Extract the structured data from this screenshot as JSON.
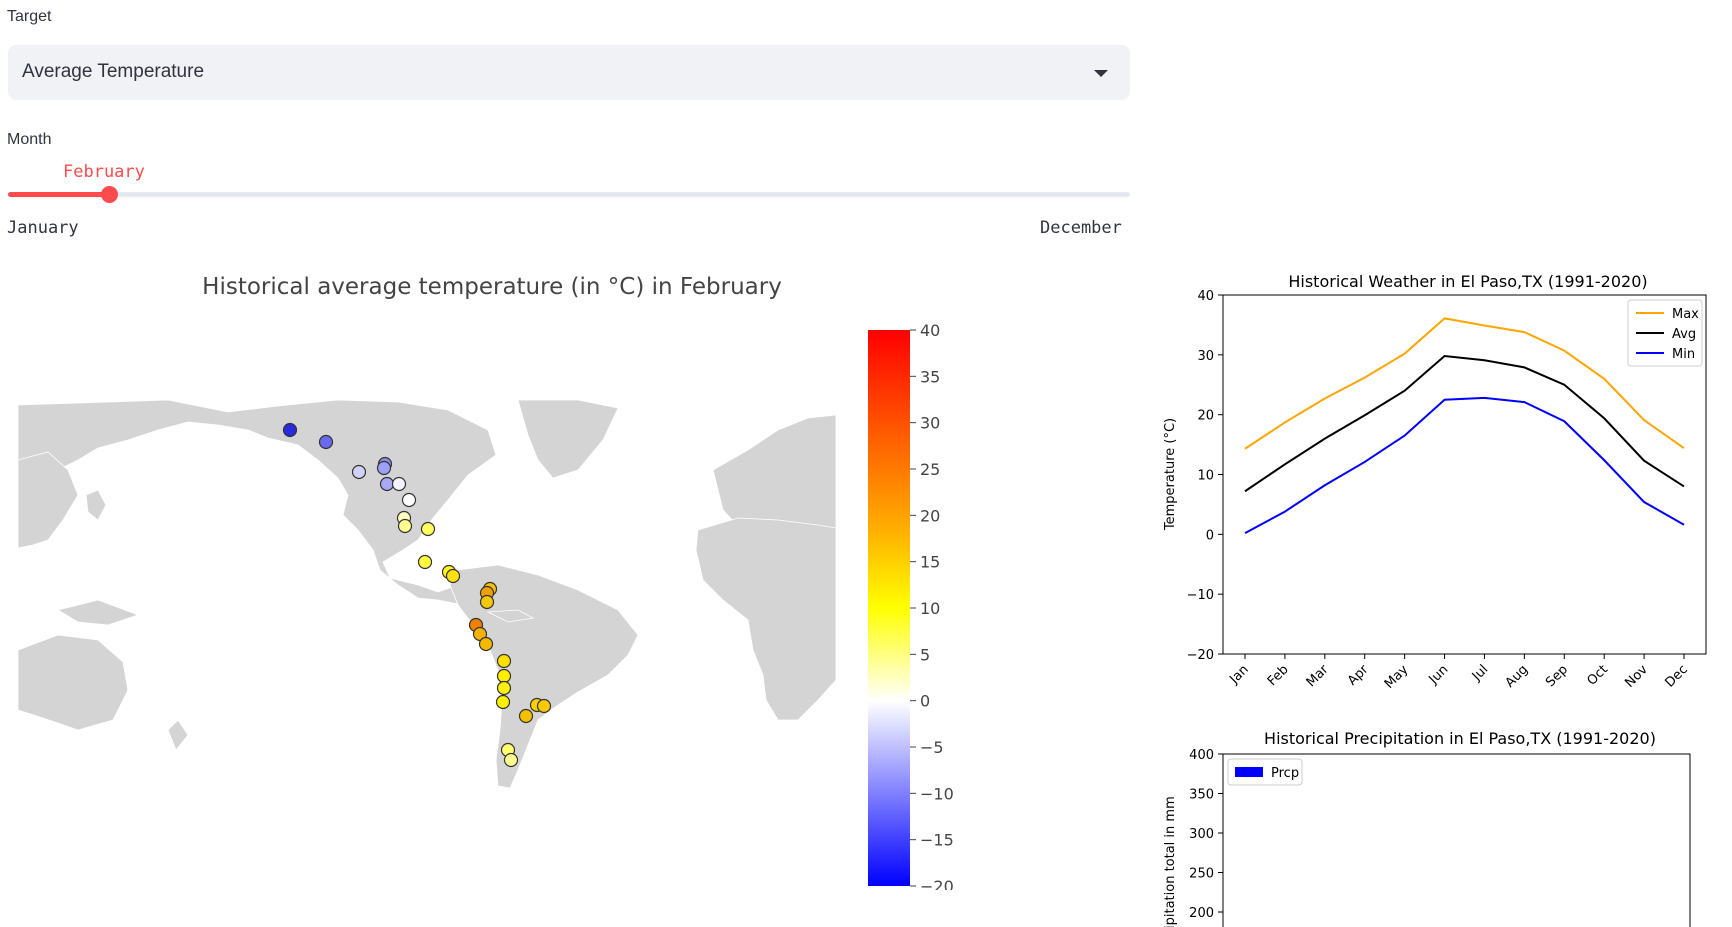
{
  "target": {
    "label": "Target",
    "value": "Average Temperature"
  },
  "month": {
    "label": "Month",
    "value": "February",
    "min_label": "January",
    "max_label": "December",
    "position": 0.0909
  },
  "map_chart": {
    "title": "Historical average temperature (in °C) in February",
    "colorbar_ticks": [
      "40",
      "35",
      "30",
      "25",
      "20",
      "15",
      "10",
      "5",
      "0",
      "−5",
      "−10",
      "−15",
      "−20"
    ],
    "colorscale": [
      "#0000ff",
      "#ffffff",
      "#ffff00",
      "#ff0000"
    ]
  },
  "chart_data": [
    {
      "type": "line",
      "title": "Historical Weather in El Paso,TX (1991-2020)",
      "ylabel": "Temperature (°C)",
      "categories": [
        "Jan",
        "Feb",
        "Mar",
        "Apr",
        "May",
        "Jun",
        "Jul",
        "Aug",
        "Sep",
        "Oct",
        "Nov",
        "Dec"
      ],
      "ylim": [
        -20,
        40
      ],
      "yticks": [
        "40",
        "30",
        "20",
        "10",
        "0",
        "−10",
        "−20"
      ],
      "legend": "top-right",
      "series": [
        {
          "name": "Max",
          "color": "#ffa500",
          "values": [
            14.3,
            18.7,
            22.7,
            26.2,
            30.2,
            36.1,
            34.9,
            33.8,
            30.7,
            26.0,
            19.1,
            14.4
          ]
        },
        {
          "name": "Avg",
          "color": "#000000",
          "values": [
            7.2,
            11.7,
            16.0,
            19.9,
            24.0,
            29.8,
            29.1,
            27.9,
            25.0,
            19.4,
            12.3,
            8.0
          ]
        },
        {
          "name": "Min",
          "color": "#0000ff",
          "values": [
            0.2,
            3.8,
            8.2,
            12.1,
            16.5,
            22.5,
            22.8,
            22.1,
            18.9,
            12.4,
            5.4,
            1.6
          ]
        }
      ]
    },
    {
      "type": "bar",
      "title": "Historical Precipitation in El Paso,TX (1991-2020)",
      "ylabel": "ipitation total in mm",
      "yticks": [
        "400",
        "350",
        "300",
        "250",
        "200"
      ],
      "ylim": [
        200,
        400
      ],
      "legend": "top-left",
      "series": [
        {
          "name": "Prcp",
          "color": "#0000ff",
          "values": []
        }
      ]
    }
  ]
}
